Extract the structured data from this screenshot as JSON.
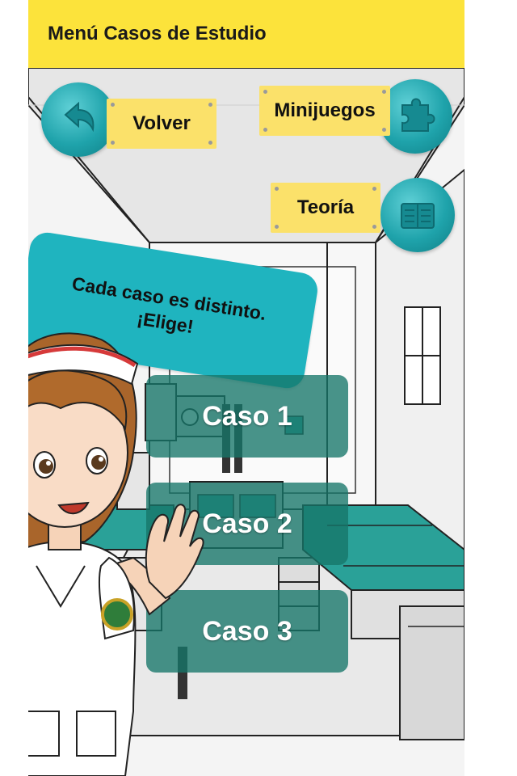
{
  "header": {
    "title": "Menú Casos de Estudio",
    "bg_color": "#fce33b"
  },
  "nav": {
    "back_label": "Volver",
    "minigames_label": "Minijuegos",
    "theory_label": "Teoría",
    "back_icon": "undo-arrow-icon",
    "minigames_icon": "puzzle-piece-icon",
    "theory_icon": "open-book-icon",
    "button_color": "#1fa3ab",
    "tag_color": "#fbe16a"
  },
  "bubble": {
    "line1": "Cada caso es distinto.",
    "line2": "¡Elige!",
    "color": "#1fb4bf"
  },
  "cases": [
    {
      "label": "Caso 1"
    },
    {
      "label": "Caso 2"
    },
    {
      "label": "Caso 3"
    }
  ],
  "nurse": {
    "badge": "emblem-badge-icon"
  }
}
